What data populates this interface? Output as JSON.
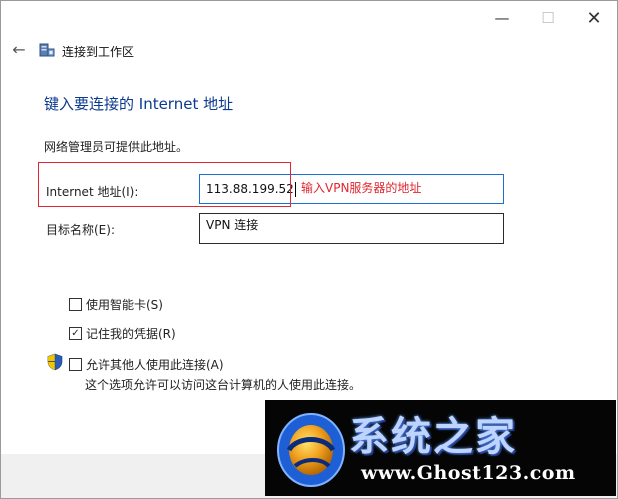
{
  "window": {
    "title": "连接到工作区",
    "minimize_glyph": "—",
    "maximize_glyph": "☐",
    "close_glyph": "✕",
    "back_glyph": "←"
  },
  "page": {
    "heading": "键入要连接的 Internet 地址",
    "description": "网络管理员可提供此地址。"
  },
  "form": {
    "internet_address_label": "Internet 地址(I):",
    "internet_address_value": "113.88.199.52",
    "destination_name_label": "目标名称(E):",
    "destination_name_value": "VPN 连接"
  },
  "annotation": {
    "callout_text": "输入VPN服务器的地址",
    "color": "#e0262f"
  },
  "options": {
    "smart_card": {
      "label": "使用智能卡(S)",
      "checked": false
    },
    "remember_credentials": {
      "label": "记住我的凭据(R)",
      "checked": true,
      "check_glyph": "✓"
    },
    "allow_others": {
      "label": "允许其他人使用此连接(A)",
      "checked": false
    },
    "allow_others_note": "这个选项允许可以访问这台计算机的人使用此连接。"
  },
  "watermark": {
    "title": "系统之家",
    "url": "www.Ghost123.com"
  },
  "icons": {
    "back": "arrow-left-icon",
    "window": "network-computer-icon",
    "shield": "uac-shield-icon",
    "logo": "globe-logo-icon"
  },
  "colors": {
    "heading": "#0b3a8f",
    "focus_border": "#1b6ed3",
    "footer": "#f0f0f0"
  }
}
